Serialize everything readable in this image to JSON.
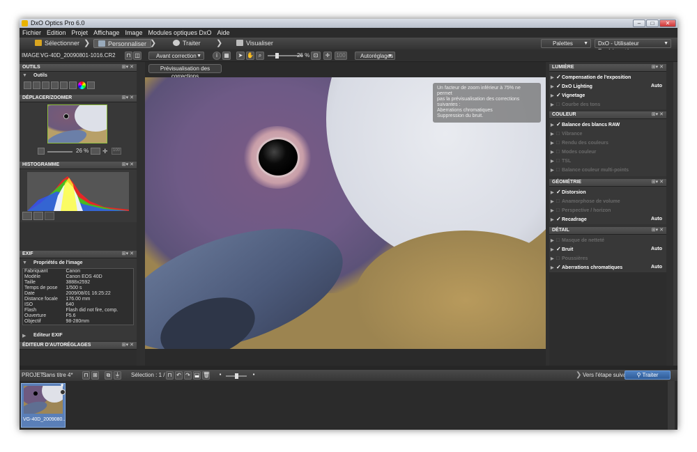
{
  "window": {
    "title": "DxO Optics Pro 6.0"
  },
  "menu": [
    "Fichier",
    "Edition",
    "Projet",
    "Affichage",
    "Image",
    "Modules optiques DxO",
    "Aide"
  ],
  "steps": {
    "select": "Sélectionner",
    "customize": "Personnaliser",
    "process": "Traiter",
    "view": "Visualiser"
  },
  "palettes": {
    "label": "Palettes",
    "workspace": "DxO - Utilisateur Expérimenté"
  },
  "toolbar": {
    "image_prefix": "IMAGE :",
    "image_name": "VG-40D_20090801-1016.CR2",
    "before_correction": "Avant correction",
    "zoom": "26 %",
    "autoreglages": "Autoréglages"
  },
  "preview_label": "Prévisualisation des corrections",
  "notice": {
    "line1": "Un facteur de zoom inférieur à 75% ne permet",
    "line2": "pas la prévisualisation des corrections",
    "line3": "suivantes :",
    "line4": "Aberrations chromatiques",
    "line5": "Suppression du bruit."
  },
  "left": {
    "tools_title": "OUTILS",
    "tools_sub": "Outils",
    "nav_title": "DÉPLACER/ZOOMER",
    "nav_zoom": "26 %",
    "hist_title": "HISTOGRAMME",
    "exif_title": "EXIF",
    "exif_sub": "Propriétés de l'image",
    "exif_rows": [
      {
        "k": "Fabriquant",
        "v": "Canon"
      },
      {
        "k": "Modèle",
        "v": "Canon EOS 40D"
      },
      {
        "k": "Taille",
        "v": "3888x2592"
      },
      {
        "k": "Temps de pose",
        "v": "1/500 s"
      },
      {
        "k": "Date",
        "v": "2009/08/01 16:25:22"
      },
      {
        "k": "Distance focale",
        "v": "176.00 mm"
      },
      {
        "k": "ISO",
        "v": "640"
      },
      {
        "k": "Flash",
        "v": "Flash did not fire, comp."
      },
      {
        "k": "Ouverture",
        "v": "F5.6"
      },
      {
        "k": "Objectif",
        "v": "98-280mm"
      }
    ],
    "exif_editor": "Editeur EXIF",
    "auto_editor_title": "ÉDITEUR D'AUTORÉGLAGES"
  },
  "right": {
    "lumiere": {
      "title": "LUMIÈRE",
      "items": [
        {
          "label": "Compensation de l'exposition",
          "checked": true,
          "enabled": true,
          "auto": ""
        },
        {
          "label": "DxO Lighting",
          "checked": true,
          "enabled": true,
          "auto": "Auto"
        },
        {
          "label": "Vignetage",
          "checked": true,
          "enabled": true,
          "auto": ""
        },
        {
          "label": "Courbe des tons",
          "checked": false,
          "enabled": false,
          "auto": ""
        }
      ]
    },
    "couleur": {
      "title": "COULEUR",
      "items": [
        {
          "label": "Balance des blancs RAW",
          "checked": true,
          "enabled": true,
          "auto": ""
        },
        {
          "label": "Vibrance",
          "checked": false,
          "enabled": false,
          "auto": ""
        },
        {
          "label": "Rendu des couleurs",
          "checked": false,
          "enabled": false,
          "auto": ""
        },
        {
          "label": "Modes couleur",
          "checked": false,
          "enabled": false,
          "auto": ""
        },
        {
          "label": "TSL",
          "checked": false,
          "enabled": false,
          "auto": ""
        },
        {
          "label": "Balance couleur multi-points",
          "checked": false,
          "enabled": false,
          "auto": ""
        }
      ]
    },
    "geometrie": {
      "title": "GÉOMÉTRIE",
      "items": [
        {
          "label": "Distorsion",
          "checked": true,
          "enabled": true,
          "auto": ""
        },
        {
          "label": "Anamorphose de volume",
          "checked": false,
          "enabled": false,
          "auto": ""
        },
        {
          "label": "Perspective / horizon",
          "checked": false,
          "enabled": false,
          "auto": ""
        },
        {
          "label": "Recadrage",
          "checked": true,
          "enabled": true,
          "auto": "Auto"
        }
      ]
    },
    "detail": {
      "title": "DÉTAIL",
      "items": [
        {
          "label": "Masque de netteté",
          "checked": false,
          "enabled": false,
          "auto": ""
        },
        {
          "label": "Bruit",
          "checked": true,
          "enabled": true,
          "auto": "Auto"
        },
        {
          "label": "Poussières",
          "checked": false,
          "enabled": false,
          "auto": ""
        },
        {
          "label": "Aberrations chromatiques",
          "checked": true,
          "enabled": true,
          "auto": "Auto"
        }
      ]
    }
  },
  "project": {
    "prefix": "PROJET :",
    "name": "Sans titre 4*",
    "selection": "Sélection : 1 / 1",
    "next_step": "Vers l'étape suivante",
    "process_btn": "Traiter"
  },
  "filmstrip": {
    "caption": "VG-40D_2009080..."
  }
}
